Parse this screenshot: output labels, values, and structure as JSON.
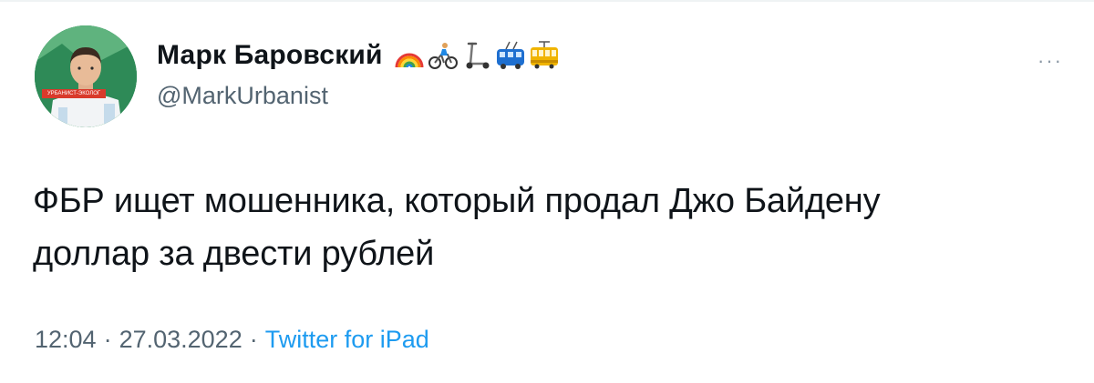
{
  "author": {
    "display_name": "Марк Баровский",
    "handle": "@MarkUrbanist",
    "avatar_badge_text": "УРБАНИСТ-ЭКОЛОГ",
    "name_emojis": [
      "rainbow",
      "cyclist",
      "scooter",
      "trolleybus",
      "tram"
    ]
  },
  "tweet": {
    "text_lines": [
      "ФБР ищет мошенника, который продал Джо Байдену",
      "доллар за двести рублей"
    ],
    "time": "12:04",
    "date": "27.03.2022",
    "separator": "·",
    "source": "Twitter for iPad"
  },
  "actions": {
    "more_label": "···"
  },
  "colors": {
    "text": "#0f1419",
    "secondary": "#536471",
    "link": "#1d9bf0"
  }
}
